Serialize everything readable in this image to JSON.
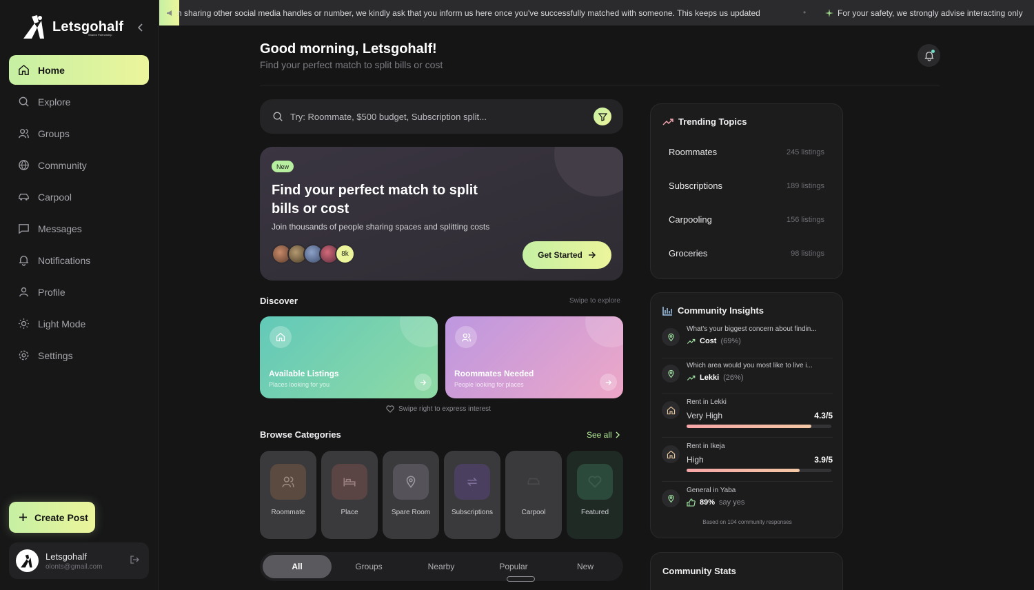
{
  "brand": {
    "name": "Letsgohalf",
    "tagline": "Shared Partnership"
  },
  "sidebar": {
    "nav": [
      {
        "label": "Home",
        "icon": "home-icon",
        "active": true
      },
      {
        "label": "Explore",
        "icon": "search-icon"
      },
      {
        "label": "Groups",
        "icon": "users-icon"
      },
      {
        "label": "Community",
        "icon": "globe-icon"
      },
      {
        "label": "Carpool",
        "icon": "car-icon"
      },
      {
        "label": "Messages",
        "icon": "message-icon"
      },
      {
        "label": "Notifications",
        "icon": "bell-icon"
      },
      {
        "label": "Profile",
        "icon": "user-icon"
      },
      {
        "label": "Light Mode",
        "icon": "sun-icon"
      },
      {
        "label": "Settings",
        "icon": "gear-icon"
      }
    ],
    "create_post": "Create Post",
    "user": {
      "name": "Letsgohalf",
      "email": "olonts@gmail.com"
    }
  },
  "announcement": {
    "text1": "n sharing other social media handles or number, we kindly ask that you inform us here once you've successfully matched with someone. This keeps us updated",
    "separator": "•",
    "text2": "For your safety, we strongly advise interacting only"
  },
  "header": {
    "greeting": "Good morning, Letsgohalf!",
    "subtitle": "Find your perfect match to split bills or cost"
  },
  "search": {
    "placeholder": "Try: Roommate, $500 budget, Subscription split..."
  },
  "hero": {
    "badge": "New",
    "title": "Find your perfect match to split bills or cost",
    "subtitle": "Join thousands of people sharing spaces and splitting costs",
    "avatar_count": "8k",
    "cta": "Get Started"
  },
  "discover": {
    "title": "Discover",
    "hint": "Swipe to explore",
    "cards": [
      {
        "title": "Available Listings",
        "subtitle": "Places looking for you"
      },
      {
        "title": "Roommates Needed",
        "subtitle": "People looking for places"
      }
    ],
    "swipe_hint": "Swipe right to express interest"
  },
  "categories": {
    "title": "Browse Categories",
    "see_all": "See all",
    "items": [
      {
        "label": "Roommate",
        "color": "#5a4a40"
      },
      {
        "label": "Place",
        "color": "#5a4444"
      },
      {
        "label": "Spare Room",
        "color": "#55525a"
      },
      {
        "label": "Subscriptions",
        "color": "#4a3f5e"
      },
      {
        "label": "Carpool",
        "color": "#3a3a3d"
      },
      {
        "label": "Featured",
        "color": "#2c4a3c"
      }
    ]
  },
  "filter_tabs": [
    "All",
    "Groups",
    "Nearby",
    "Popular",
    "New"
  ],
  "trending": {
    "title": "Trending Topics",
    "items": [
      {
        "name": "Roommates",
        "count": "245 listings"
      },
      {
        "name": "Subscriptions",
        "count": "189 listings"
      },
      {
        "name": "Carpooling",
        "count": "156 listings"
      },
      {
        "name": "Groceries",
        "count": "98 listings"
      }
    ]
  },
  "insights": {
    "title": "Community Insights",
    "polls": [
      {
        "question": "What's your biggest concern about findin...",
        "answer": "Cost",
        "pct": "(69%)"
      },
      {
        "question": "Which area would you most like to live i...",
        "answer": "Lekki",
        "pct": "(26%)"
      }
    ],
    "ratings": [
      {
        "label": "Rent in Lekki",
        "level": "Very High",
        "value": "4.3/5",
        "fraction": 0.86
      },
      {
        "label": "Rent in Ikeja",
        "level": "High",
        "value": "3.9/5",
        "fraction": 0.78
      }
    ],
    "general": {
      "label": "General in Yaba",
      "value": "89%",
      "suffix": "say yes"
    },
    "based_on": "Based on 104 community responses"
  },
  "stats": {
    "title": "Community Stats"
  },
  "colors": {
    "accent_start": "#c6f0a3",
    "accent_end": "#ecf59b",
    "background": "#151516"
  }
}
